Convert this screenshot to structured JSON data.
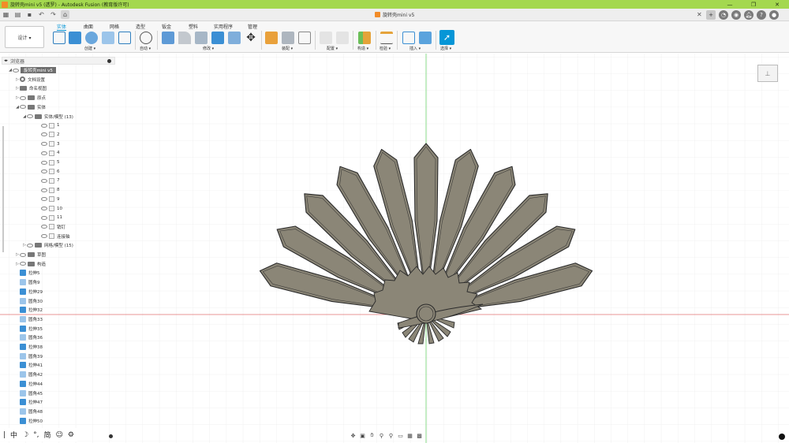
{
  "window": {
    "title": "旋转壳mini v5 (透罗) - Autodesk Fusion (教育版许可)",
    "controls": [
      "—",
      "❐",
      "✕"
    ]
  },
  "document_tab": {
    "label": "旋转壳mini v5"
  },
  "toolbar": {
    "workspace": "设计 ▾",
    "category_tabs": [
      "实体",
      "曲面",
      "网格",
      "造型",
      "钣金",
      "塑料",
      "实用程序",
      "管理"
    ],
    "active_tab": "实体",
    "groups": [
      "创建 ▾",
      "自动 ▾",
      "修改 ▾",
      "装配 ▾",
      "配置 ▾",
      "构造 ▾",
      "检验 ▾",
      "插入 ▾",
      "选择 ▾"
    ]
  },
  "browser": {
    "title": "浏览器",
    "rows": [
      {
        "depth": 0,
        "arrow": "◢",
        "type": "root",
        "label": "旋转壳mini v5"
      },
      {
        "depth": 1,
        "arrow": "▷",
        "type": "gear",
        "label": "文档设置"
      },
      {
        "depth": 1,
        "arrow": "▷",
        "type": "folder",
        "label": "命名视图"
      },
      {
        "depth": 1,
        "arrow": "▷",
        "type": "folder",
        "label": "原点",
        "eye": true
      },
      {
        "depth": 1,
        "arrow": "◢",
        "type": "folder",
        "label": "实体",
        "eye": true
      },
      {
        "depth": 2,
        "arrow": "◢",
        "type": "folder",
        "label": "实体/模型 (13)",
        "eye": true
      },
      {
        "depth": 3,
        "arrow": "",
        "type": "body",
        "label": "1",
        "eye": true
      },
      {
        "depth": 3,
        "arrow": "",
        "type": "body",
        "label": "2",
        "eye": true
      },
      {
        "depth": 3,
        "arrow": "",
        "type": "body",
        "label": "3",
        "eye": true
      },
      {
        "depth": 3,
        "arrow": "",
        "type": "body",
        "label": "4",
        "eye": true
      },
      {
        "depth": 3,
        "arrow": "",
        "type": "body",
        "label": "5",
        "eye": true
      },
      {
        "depth": 3,
        "arrow": "",
        "type": "body",
        "label": "6",
        "eye": true
      },
      {
        "depth": 3,
        "arrow": "",
        "type": "body",
        "label": "7",
        "eye": true
      },
      {
        "depth": 3,
        "arrow": "",
        "type": "body",
        "label": "8",
        "eye": true
      },
      {
        "depth": 3,
        "arrow": "",
        "type": "body",
        "label": "9",
        "eye": true
      },
      {
        "depth": 3,
        "arrow": "",
        "type": "body",
        "label": "10",
        "eye": true
      },
      {
        "depth": 3,
        "arrow": "",
        "type": "body",
        "label": "11",
        "eye": true
      },
      {
        "depth": 3,
        "arrow": "",
        "type": "body",
        "label": "销钉",
        "eye": true
      },
      {
        "depth": 3,
        "arrow": "",
        "type": "body",
        "label": "连接轴",
        "eye": true
      },
      {
        "depth": 2,
        "arrow": "▷",
        "type": "folder",
        "label": "网格/模型 (15)",
        "eye": true
      },
      {
        "depth": 1,
        "arrow": "▷",
        "type": "folder",
        "label": "草图",
        "eye": true
      },
      {
        "depth": 1,
        "arrow": "▷",
        "type": "folder",
        "label": "构造",
        "eye": true
      },
      {
        "depth": 1,
        "arrow": "",
        "type": "extrude",
        "label": "拉伸5"
      },
      {
        "depth": 1,
        "arrow": "",
        "type": "fillet",
        "label": "圆角9"
      },
      {
        "depth": 1,
        "arrow": "",
        "type": "extrude",
        "label": "拉伸29"
      },
      {
        "depth": 1,
        "arrow": "",
        "type": "fillet",
        "label": "圆角30"
      },
      {
        "depth": 1,
        "arrow": "",
        "type": "extrude",
        "label": "拉伸32"
      },
      {
        "depth": 1,
        "arrow": "",
        "type": "fillet",
        "label": "圆角33"
      },
      {
        "depth": 1,
        "arrow": "",
        "type": "extrude",
        "label": "拉伸35"
      },
      {
        "depth": 1,
        "arrow": "",
        "type": "fillet",
        "label": "圆角36"
      },
      {
        "depth": 1,
        "arrow": "",
        "type": "extrude",
        "label": "拉伸38"
      },
      {
        "depth": 1,
        "arrow": "",
        "type": "fillet",
        "label": "圆角39"
      },
      {
        "depth": 1,
        "arrow": "",
        "type": "extrude",
        "label": "拉伸41"
      },
      {
        "depth": 1,
        "arrow": "",
        "type": "fillet",
        "label": "圆角42"
      },
      {
        "depth": 1,
        "arrow": "",
        "type": "extrude",
        "label": "拉伸44"
      },
      {
        "depth": 1,
        "arrow": "",
        "type": "fillet",
        "label": "圆角45"
      },
      {
        "depth": 1,
        "arrow": "",
        "type": "extrude",
        "label": "拉伸47"
      },
      {
        "depth": 1,
        "arrow": "",
        "type": "fillet",
        "label": "圆角48"
      },
      {
        "depth": 1,
        "arrow": "",
        "type": "extrude",
        "label": "拉伸50"
      }
    ]
  },
  "ime_bar": {
    "items": [
      "中",
      "☽",
      "°,",
      "简",
      "☺",
      "⚙"
    ]
  },
  "colors": {
    "title_bar": "#a4d84f",
    "accent": "#0696d7",
    "model_fill": "#8b8677",
    "model_edge": "#2b2b2b",
    "x_axis": "#e07070",
    "y_axis": "#6ed36e",
    "grid": "#e6e6e6"
  }
}
